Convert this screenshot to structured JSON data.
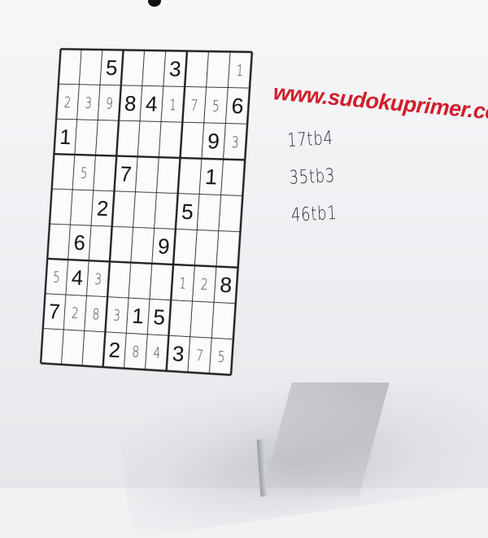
{
  "site": {
    "url": "www.sudokuprimer.com",
    "logo_text": "",
    "colors": {
      "url": "#d01e2a",
      "ink": "#111111",
      "pencil": "#3a3a44"
    }
  },
  "notes": [
    "17tb4",
    "35tb3",
    "46tb1"
  ],
  "sudoku": {
    "given": [
      [
        0,
        0,
        5,
        0,
        0,
        3,
        0,
        0,
        0
      ],
      [
        0,
        0,
        0,
        8,
        4,
        0,
        0,
        0,
        6
      ],
      [
        1,
        0,
        0,
        0,
        0,
        0,
        0,
        9,
        0
      ],
      [
        0,
        0,
        0,
        7,
        0,
        0,
        0,
        1,
        0
      ],
      [
        0,
        0,
        2,
        0,
        0,
        0,
        5,
        0,
        0
      ],
      [
        0,
        6,
        0,
        0,
        0,
        9,
        0,
        0,
        0
      ],
      [
        0,
        4,
        0,
        0,
        0,
        0,
        0,
        0,
        8
      ],
      [
        7,
        0,
        0,
        0,
        1,
        5,
        0,
        0,
        0
      ],
      [
        0,
        0,
        0,
        2,
        0,
        0,
        3,
        0,
        0
      ]
    ],
    "handwritten": [
      [
        0,
        0,
        0,
        0,
        0,
        0,
        0,
        0,
        1
      ],
      [
        2,
        3,
        9,
        0,
        0,
        1,
        7,
        5,
        0
      ],
      [
        0,
        0,
        0,
        0,
        0,
        0,
        0,
        0,
        3
      ],
      [
        0,
        5,
        0,
        0,
        0,
        0,
        0,
        0,
        0
      ],
      [
        0,
        0,
        0,
        0,
        0,
        0,
        0,
        0,
        0
      ],
      [
        0,
        0,
        0,
        0,
        0,
        0,
        0,
        0,
        0
      ],
      [
        5,
        0,
        3,
        0,
        0,
        0,
        1,
        2,
        0
      ],
      [
        0,
        2,
        8,
        3,
        0,
        0,
        0,
        0,
        0
      ],
      [
        0,
        0,
        0,
        0,
        8,
        4,
        0,
        7,
        5
      ]
    ]
  }
}
